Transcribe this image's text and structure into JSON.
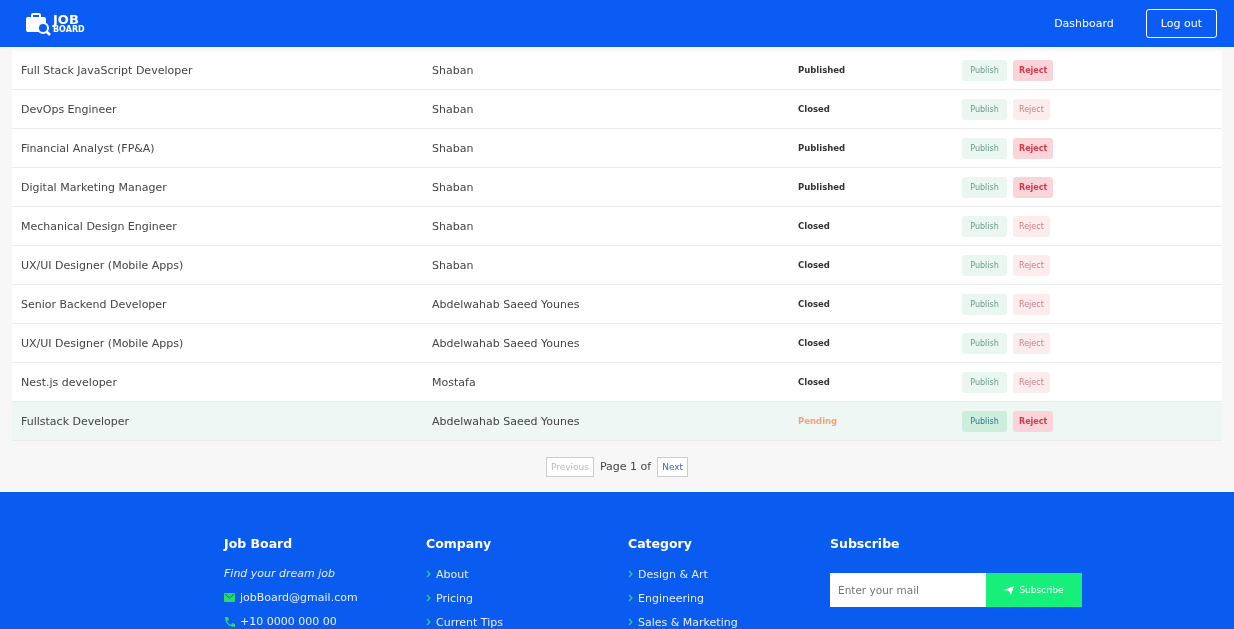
{
  "header": {
    "logo_top": "JOB",
    "logo_bottom": "BOARD",
    "nav": [
      {
        "label": "Dashboard",
        "kind": "link"
      },
      {
        "label": "Log out",
        "kind": "outlined"
      }
    ]
  },
  "rows": [
    {
      "title": "Full Stack JavaScript Developer",
      "owner": "Shaban",
      "status": "Published",
      "kind": "published",
      "publish": {
        "label": "Publish",
        "disabled": true
      },
      "reject": {
        "label": "Reject",
        "disabled": false
      },
      "highlighted": false
    },
    {
      "title": "DevOps Engineer",
      "owner": "Shaban",
      "status": "Closed",
      "kind": "closed",
      "publish": {
        "label": "Publish",
        "disabled": true
      },
      "reject": {
        "label": "Reject",
        "disabled": true
      },
      "highlighted": false
    },
    {
      "title": "Financial Analyst (FP&A)",
      "owner": "Shaban",
      "status": "Published",
      "kind": "published",
      "publish": {
        "label": "Publish",
        "disabled": true
      },
      "reject": {
        "label": "Reject",
        "disabled": false
      },
      "highlighted": false
    },
    {
      "title": "Digital Marketing Manager",
      "owner": "Shaban",
      "status": "Published",
      "kind": "published",
      "publish": {
        "label": "Publish",
        "disabled": true
      },
      "reject": {
        "label": "Reject",
        "disabled": false
      },
      "highlighted": false
    },
    {
      "title": "Mechanical Design Engineer",
      "owner": "Shaban",
      "status": "Closed",
      "kind": "closed",
      "publish": {
        "label": "Publish",
        "disabled": true
      },
      "reject": {
        "label": "Reject",
        "disabled": true
      },
      "highlighted": false
    },
    {
      "title": "UX/UI Designer (Mobile Apps)",
      "owner": "Shaban",
      "status": "Closed",
      "kind": "closed",
      "publish": {
        "label": "Publish",
        "disabled": true
      },
      "reject": {
        "label": "Reject",
        "disabled": true
      },
      "highlighted": false
    },
    {
      "title": "Senior Backend Developer",
      "owner": "Abdelwahab Saeed Younes",
      "status": "Closed",
      "kind": "closed",
      "publish": {
        "label": "Publish",
        "disabled": true
      },
      "reject": {
        "label": "Reject",
        "disabled": true
      },
      "highlighted": false
    },
    {
      "title": "UX/UI Designer (Mobile Apps)",
      "owner": "Abdelwahab Saeed Younes",
      "status": "Closed",
      "kind": "closed",
      "publish": {
        "label": "Publish",
        "disabled": true
      },
      "reject": {
        "label": "Reject",
        "disabled": true
      },
      "highlighted": false
    },
    {
      "title": "Nest.js developer",
      "owner": "Mostafa",
      "status": "Closed",
      "kind": "closed",
      "publish": {
        "label": "Publish",
        "disabled": true
      },
      "reject": {
        "label": "Reject",
        "disabled": true
      },
      "highlighted": false
    },
    {
      "title": "Fullstack Developer",
      "owner": "Abdelwahab Saeed Younes",
      "status": "Pending",
      "kind": "pending",
      "publish": {
        "label": "Publish",
        "disabled": false
      },
      "reject": {
        "label": "Reject",
        "disabled": false
      },
      "highlighted": true
    }
  ],
  "pagination": {
    "previous": {
      "label": "Previous",
      "disabled": true
    },
    "page_text": "Page 1 of",
    "next": {
      "label": "Next",
      "disabled": false
    }
  },
  "footer": {
    "brand": {
      "title": "Job Board",
      "tagline": "Find your dream job",
      "contacts": [
        {
          "kind": "mail",
          "text": "jobBoard@gmail.com"
        },
        {
          "kind": "phone",
          "text": "+10 0000 000 00"
        }
      ]
    },
    "columns": [
      {
        "title": "Company",
        "links": [
          "About",
          "Pricing",
          "Current Tips"
        ]
      },
      {
        "title": "Category",
        "links": [
          "Design & Art",
          "Engineering",
          "Sales & Marketing"
        ]
      }
    ],
    "subscribe": {
      "title": "Subscribe",
      "placeholder": "Enter your mail",
      "button": "Subscribe"
    }
  }
}
